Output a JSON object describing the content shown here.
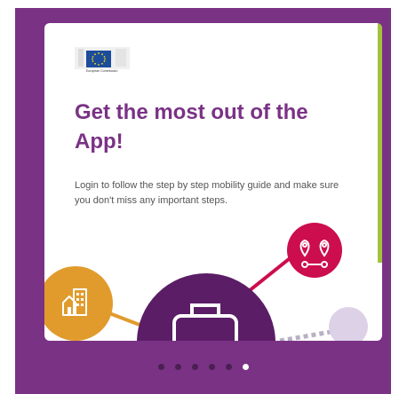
{
  "onboarding": {
    "logo": {
      "icon": "european-commission-logo",
      "text": "European Commission"
    },
    "title": "Get the most out of the App!",
    "body": "Login to follow the step by step mobility guide and make sure you don't miss any important steps.",
    "pagination": {
      "total": 6,
      "active_index": 5
    }
  },
  "colors": {
    "brand_purple": "#7a3285",
    "accent_green": "#a3c23c",
    "pin_red": "#cc0d4e",
    "building_orange": "#e19b2c",
    "briefcase_purple": "#5a1d66",
    "light_lilac": "#ddd1e8"
  }
}
